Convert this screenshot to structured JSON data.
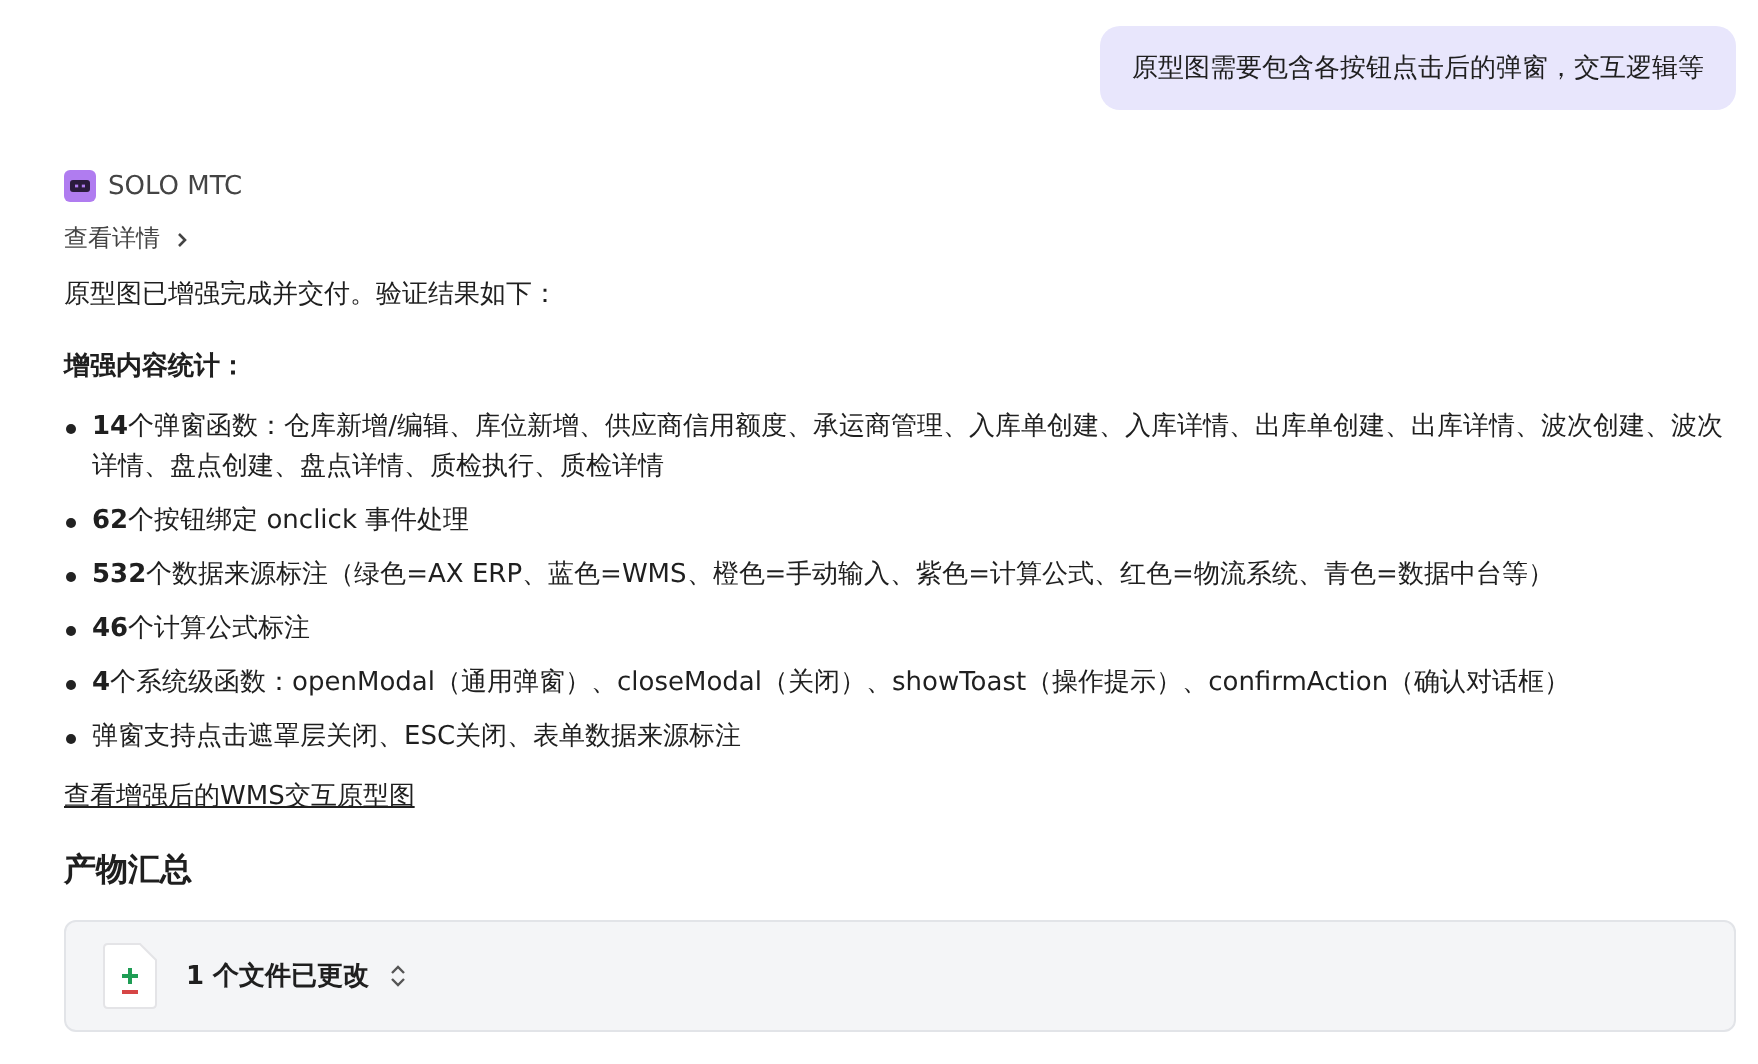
{
  "user_message": "原型图需要包含各按钮点击后的弹窗，交互逻辑等",
  "assistant": {
    "name": "SOLO MTC",
    "details_link": "查看详情"
  },
  "intro": "原型图已增强完成并交付。验证结果如下：",
  "stats_heading": "增强内容统计：",
  "bullets": [
    "**14**个弹窗函数：仓库新增/编辑、库位新增、供应商信用额度、承运商管理、入库单创建、入库详情、出库单创建、出库详情、波次创建、波次详情、盘点创建、盘点详情、质检执行、质检详情",
    "**62**个按钮绑定 onclick 事件处理",
    "**532**个数据来源标注（绿色=AX ERP、蓝色=WMS、橙色=手动输入、紫色=计算公式、红色=物流系统、青色=数据中台等）",
    "**46**个计算公式标注",
    "**4**个系统级函数：openModal（通用弹窗）、closeModal（关闭）、showToast（操作提示）、confirmAction（确认对话框）",
    "弹窗支持点击遮罩层关闭、ESC关闭、表单数据来源标注"
  ],
  "prototype_link": "查看增强后的WMS交互原型图",
  "artifacts": {
    "heading": "产物汇总",
    "files_changed": "1 个文件已更改"
  }
}
